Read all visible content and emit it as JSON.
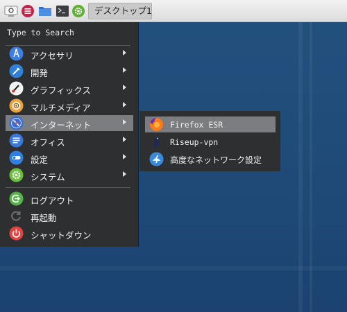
{
  "panel": {
    "workspace_label": "デスクトップ1",
    "icons": [
      "display-settings-icon",
      "app-menu-icon",
      "file-manager-icon",
      "terminal-icon",
      "settings-gear-icon"
    ]
  },
  "menu": {
    "search_placeholder": "Type to Search",
    "categories": [
      {
        "label": "アクセサリ",
        "icon": "accessories-icon",
        "color": "#3c7fe0"
      },
      {
        "label": "開発",
        "icon": "development-icon",
        "color": "#2f7fd8"
      },
      {
        "label": "グラフィックス",
        "icon": "graphics-icon",
        "color": "#f0f0f0"
      },
      {
        "label": "マルチメディア",
        "icon": "multimedia-icon",
        "color": "#e8a33b"
      },
      {
        "label": "インターネット",
        "icon": "internet-icon",
        "color": "#3a6fd0",
        "selected": true
      },
      {
        "label": "オフィス",
        "icon": "office-icon",
        "color": "#3a78d8"
      },
      {
        "label": "設定",
        "icon": "settings-toggle-icon",
        "color": "#2f7fe0"
      },
      {
        "label": "システム",
        "icon": "system-gear-icon",
        "color": "#6cbf3b"
      }
    ],
    "actions": [
      {
        "label": "ログアウト",
        "icon": "logout-icon",
        "color": "#58b24a"
      },
      {
        "label": "再起動",
        "icon": "restart-icon",
        "color": "#777777"
      },
      {
        "label": "シャットダウン",
        "icon": "shutdown-icon",
        "color": "#e24444"
      }
    ]
  },
  "submenu": {
    "items": [
      {
        "label": "Firefox ESR",
        "icon": "firefox-icon",
        "selected": true
      },
      {
        "label": "Riseup-vpn",
        "icon": "riseup-vpn-icon"
      },
      {
        "label": "高度なネットワーク設定",
        "icon": "network-settings-icon"
      }
    ]
  }
}
